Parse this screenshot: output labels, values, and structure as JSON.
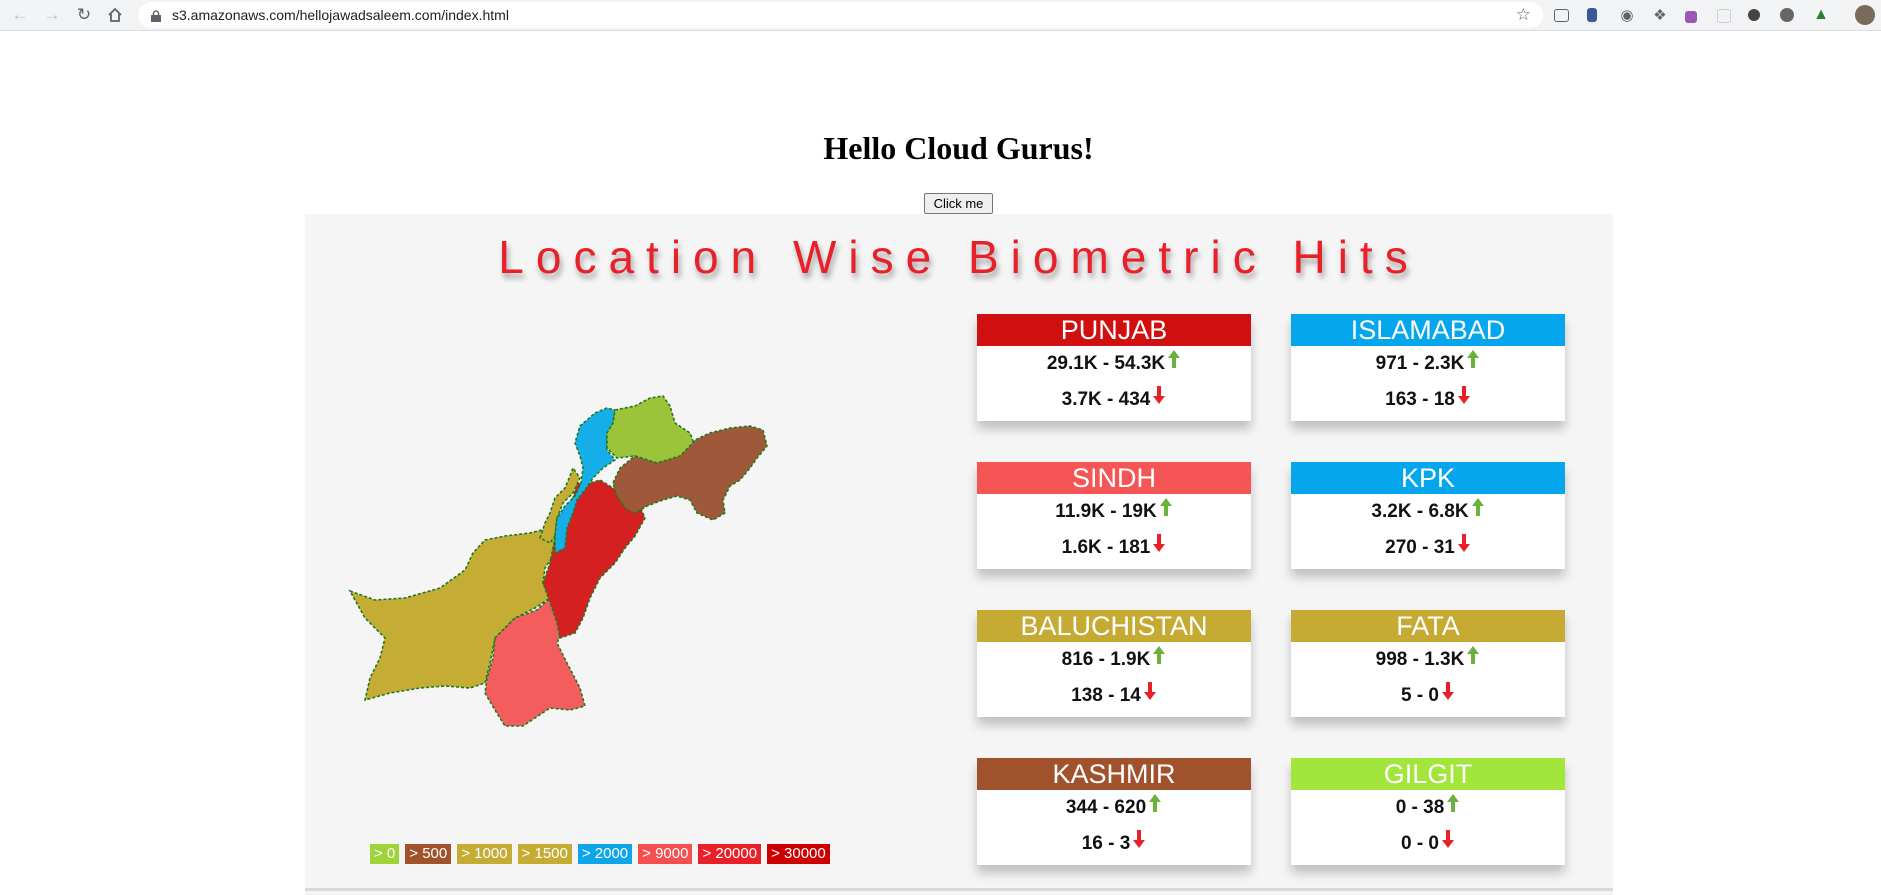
{
  "browser": {
    "url": "s3.amazonaws.com/hellojawadsaleem.com/index.html"
  },
  "page": {
    "title": "Hello Cloud Gurus!",
    "button_label": "Click me"
  },
  "dashboard": {
    "title": "Location Wise Biometric Hits",
    "legend": [
      {
        "label": "> 0",
        "color": "#9fd33a"
      },
      {
        "label": "> 500",
        "color": "#a0522d"
      },
      {
        "label": "> 1000",
        "color": "#c5ad35"
      },
      {
        "label": "> 1500",
        "color": "#c5ad35"
      },
      {
        "label": "> 2000",
        "color": "#0ea5e9"
      },
      {
        "label": "> 9000",
        "color": "#f45050"
      },
      {
        "label": "> 20000",
        "color": "#e8202a"
      },
      {
        "label": "> 30000",
        "color": "#cc0000"
      }
    ],
    "regions": [
      {
        "name": "PUNJAB",
        "color": "#d01010",
        "up": "29.1K - 54.3K",
        "down": "3.7K - 434"
      },
      {
        "name": "ISLAMABAD",
        "color": "#06a6ec",
        "up": "971 - 2.3K",
        "down": "163 - 18"
      },
      {
        "name": "SINDH",
        "color": "#f55555",
        "up": "11.9K - 19K",
        "down": "1.6K - 181"
      },
      {
        "name": "KPK",
        "color": "#06a6ec",
        "up": "3.2K - 6.8K",
        "down": "270 - 31"
      },
      {
        "name": "BALUCHISTAN",
        "color": "#c5ab33",
        "up": "816 - 1.9K",
        "down": "138 - 14"
      },
      {
        "name": "FATA",
        "color": "#c5ab33",
        "up": "998 - 1.3K",
        "down": "5 - 0"
      },
      {
        "name": "KASHMIR",
        "color": "#a0522d",
        "up": "344 - 620",
        "down": "16 - 3"
      },
      {
        "name": "GILGIT",
        "color": "#a2e63c",
        "up": "0 - 38",
        "down": "0 - 0"
      }
    ],
    "map_colors": {
      "baluchistan": "#c5ad35",
      "sindh": "#f45d5d",
      "punjab": "#d42020",
      "kpk": "#15aee9",
      "fata": "#c5ad35",
      "gilgit": "#9cc43a",
      "kashmir": "#a0583a"
    }
  }
}
